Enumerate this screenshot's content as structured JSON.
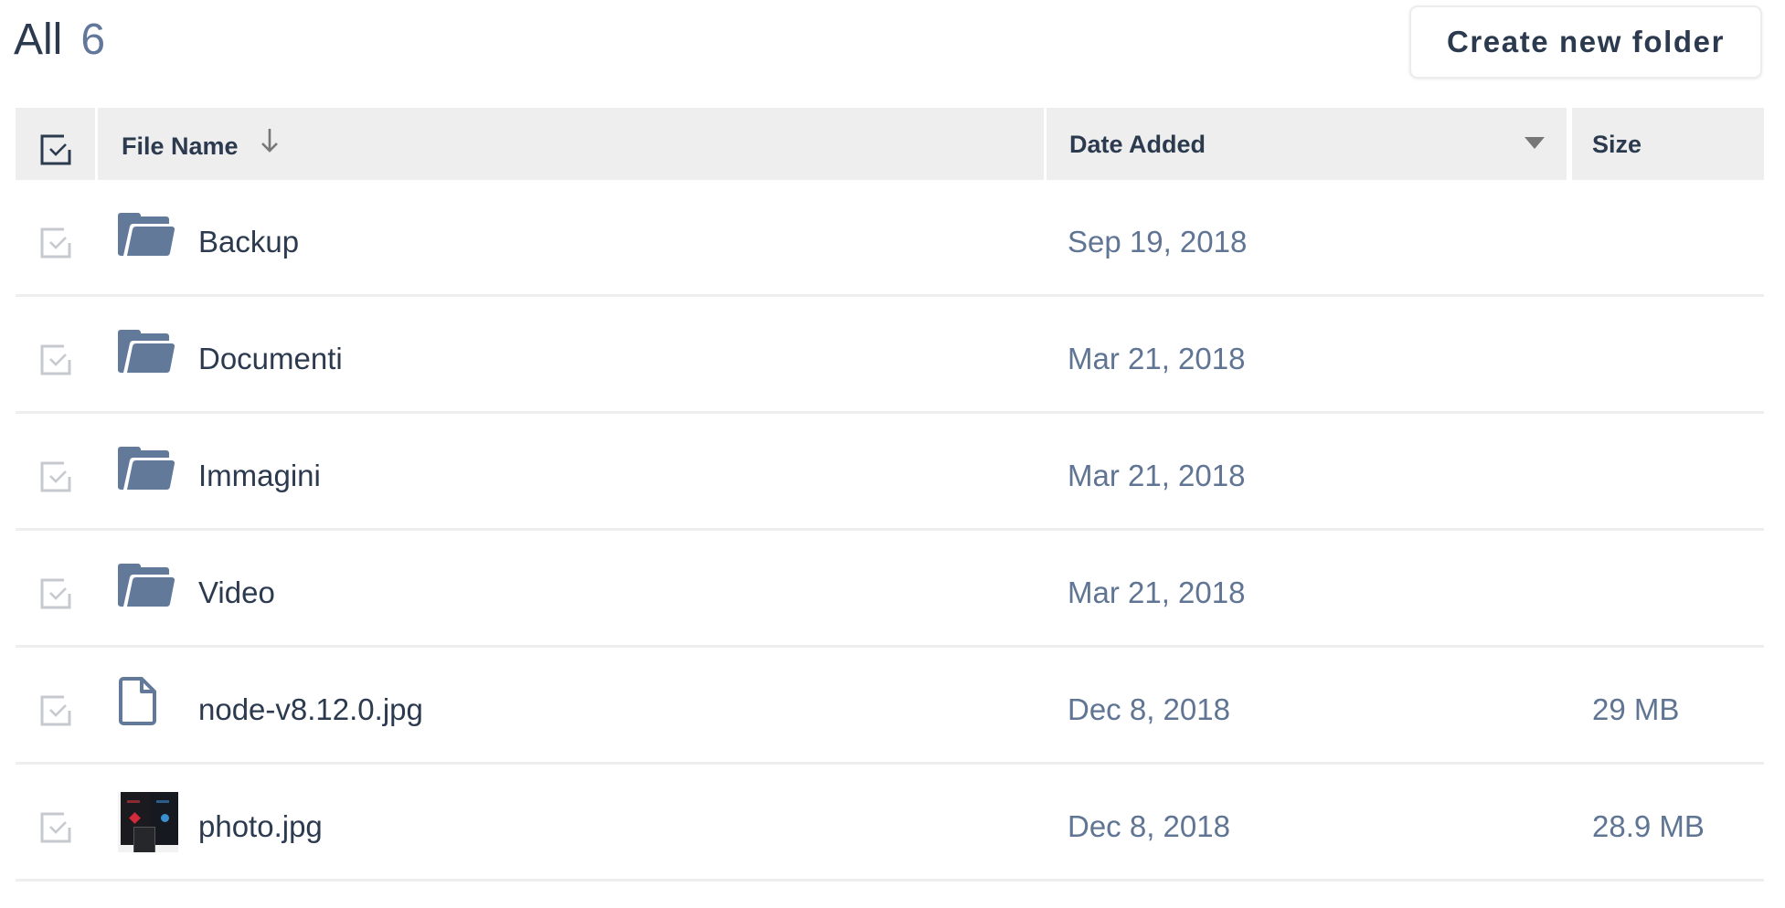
{
  "header": {
    "title": "All",
    "count": "6",
    "create_button_label": "Create new folder"
  },
  "table": {
    "columns": {
      "select_all_icon": "checkbox-checked-icon",
      "name": "File Name",
      "name_sort_icon": "arrow-down-icon",
      "date": "Date Added",
      "date_menu_icon": "triangle-down-icon",
      "size": "Size"
    },
    "rows": [
      {
        "type": "folder",
        "icon": "folder-open-icon",
        "name": "Backup",
        "date": "Sep 19, 2018",
        "size": ""
      },
      {
        "type": "folder",
        "icon": "folder-open-icon",
        "name": "Documenti",
        "date": "Mar 21, 2018",
        "size": ""
      },
      {
        "type": "folder",
        "icon": "folder-open-icon",
        "name": "Immagini",
        "date": "Mar 21, 2018",
        "size": ""
      },
      {
        "type": "folder",
        "icon": "folder-open-icon",
        "name": "Video",
        "date": "Mar 21, 2018",
        "size": ""
      },
      {
        "type": "file",
        "icon": "file-icon",
        "name": "node-v8.12.0.jpg",
        "date": "Dec 8, 2018",
        "size": "29 MB"
      },
      {
        "type": "image",
        "icon": "image-thumbnail",
        "name": "photo.jpg",
        "date": "Dec 8, 2018",
        "size": "28.9 MB"
      }
    ]
  },
  "colors": {
    "text_primary": "#2b3a4e",
    "text_secondary": "#5f7593",
    "icon_fill": "#63799a",
    "header_bg": "#eeeeee",
    "divider": "#eeeeee"
  }
}
